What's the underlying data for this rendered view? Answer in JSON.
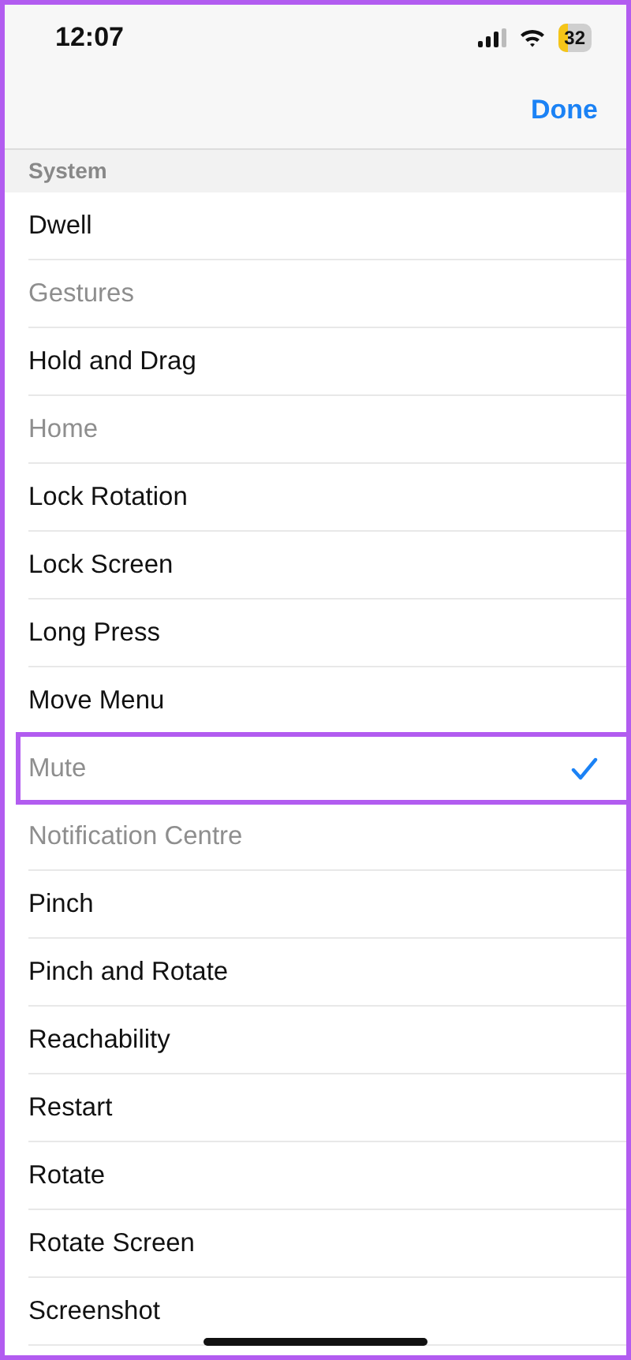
{
  "status_bar": {
    "time": "12:07",
    "battery": "32"
  },
  "nav_bar": {
    "done_button": "Done"
  },
  "section": {
    "title": "System",
    "items": [
      {
        "label": "Dwell",
        "disabled": false,
        "selected": false,
        "highlighted": false
      },
      {
        "label": "Gestures",
        "disabled": true,
        "selected": false,
        "highlighted": false
      },
      {
        "label": "Hold and Drag",
        "disabled": false,
        "selected": false,
        "highlighted": false
      },
      {
        "label": "Home",
        "disabled": true,
        "selected": false,
        "highlighted": false
      },
      {
        "label": "Lock Rotation",
        "disabled": false,
        "selected": false,
        "highlighted": false
      },
      {
        "label": "Lock Screen",
        "disabled": false,
        "selected": false,
        "highlighted": false
      },
      {
        "label": "Long Press",
        "disabled": false,
        "selected": false,
        "highlighted": false
      },
      {
        "label": "Move Menu",
        "disabled": false,
        "selected": false,
        "highlighted": false
      },
      {
        "label": "Mute",
        "disabled": true,
        "selected": true,
        "highlighted": true
      },
      {
        "label": "Notification Centre",
        "disabled": true,
        "selected": false,
        "highlighted": false
      },
      {
        "label": "Pinch",
        "disabled": false,
        "selected": false,
        "highlighted": false
      },
      {
        "label": "Pinch and Rotate",
        "disabled": false,
        "selected": false,
        "highlighted": false
      },
      {
        "label": "Reachability",
        "disabled": false,
        "selected": false,
        "highlighted": false
      },
      {
        "label": "Restart",
        "disabled": false,
        "selected": false,
        "highlighted": false
      },
      {
        "label": "Rotate",
        "disabled": false,
        "selected": false,
        "highlighted": false
      },
      {
        "label": "Rotate Screen",
        "disabled": false,
        "selected": false,
        "highlighted": false
      },
      {
        "label": "Screenshot",
        "disabled": false,
        "selected": false,
        "highlighted": false
      }
    ]
  }
}
